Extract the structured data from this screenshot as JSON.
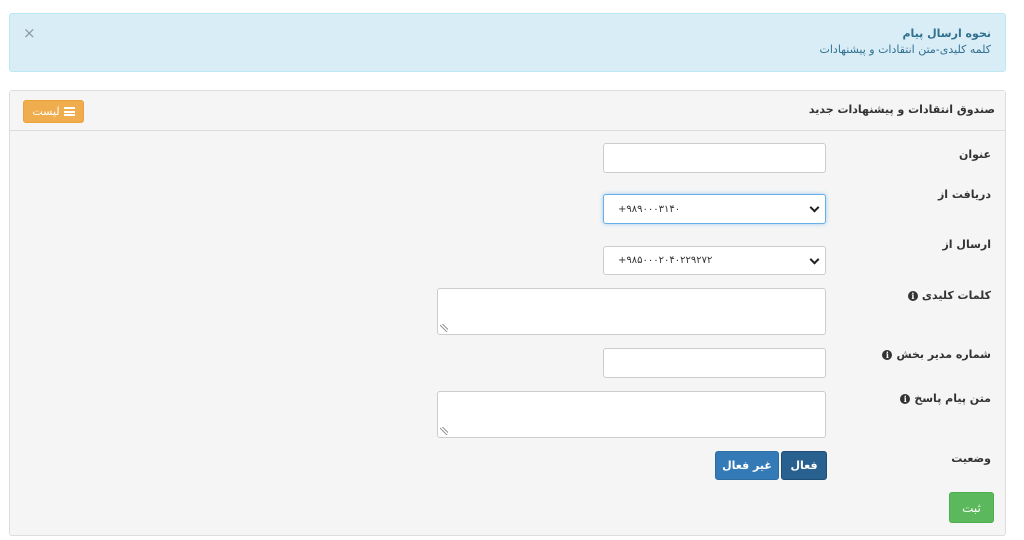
{
  "alert": {
    "title": "نحوه ارسال پیام",
    "body": "کلمه کلیدی-متن انتقادات و پیشنهادات",
    "close_glyph": "×"
  },
  "panel": {
    "title": "صندوق انتقادات و پیشنهادات جدید",
    "list_button": "لیست",
    "list_button_icon": "list-icon"
  },
  "form": {
    "subject_label": "عنوان",
    "subject_value": "",
    "receive_from_label": "دریافت از",
    "receive_from_value": "+۹۸۹۰۰۰۳۱۴۰",
    "send_from_label": "ارسال از",
    "send_from_value": "+۹۸۵۰۰۰۲۰۴۰۲۲۹۲۷۲",
    "keywords_label": "کلمات کلیدی",
    "keywords_value": "",
    "manager_number_label": "شماره مدیر بخش",
    "manager_number_value": "",
    "reply_text_label": "متن پیام پاسخ",
    "reply_text_value": "",
    "status_label": "وضعیت",
    "status_active": "فعال",
    "status_inactive": "غیر فعال",
    "status_selected": "فعال",
    "submit": "ثبت",
    "info_glyph": "i"
  },
  "colors": {
    "alert_bg": "#d9edf7",
    "warning": "#f0ad4e",
    "primary": "#337ab7",
    "primary_active": "#286090",
    "success": "#5cb85c"
  }
}
